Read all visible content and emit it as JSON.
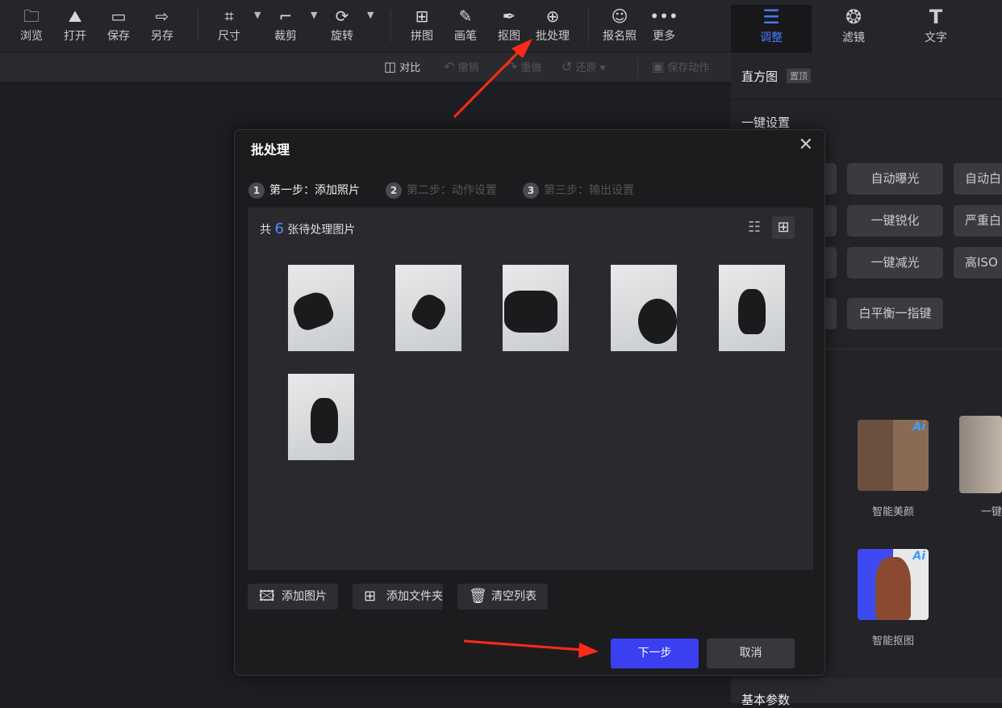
{
  "toolbar": {
    "items": [
      {
        "label": "浏览",
        "icon": "folder-icon"
      },
      {
        "label": "打开",
        "icon": "open-image-icon"
      },
      {
        "label": "保存",
        "icon": "save-icon"
      },
      {
        "label": "另存",
        "icon": "save-as-icon"
      },
      {
        "label": "尺寸",
        "icon": "resize-icon"
      },
      {
        "label": "裁剪",
        "icon": "crop-icon"
      },
      {
        "label": "旋转",
        "icon": "rotate-icon"
      },
      {
        "label": "拼图",
        "icon": "collage-icon"
      },
      {
        "label": "画笔",
        "icon": "brush-icon"
      },
      {
        "label": "抠图",
        "icon": "pen-cutout-icon"
      },
      {
        "label": "批处理",
        "icon": "batch-icon"
      },
      {
        "label": "报名照",
        "icon": "id-photo-icon"
      },
      {
        "label": "更多",
        "icon": "more-icon"
      }
    ]
  },
  "subbar": {
    "compare": "对比",
    "undo": "撤销",
    "redo": "重做",
    "restore": "还原",
    "save_action": "保存动作"
  },
  "right_tabs": [
    {
      "label": "调整",
      "active": true
    },
    {
      "label": "滤镜"
    },
    {
      "label": "文字"
    }
  ],
  "panel": {
    "histogram": "直方图",
    "pin": "置顶",
    "one_click": "一键设置",
    "buttons": [
      "自动曝光",
      "自动白",
      "一键锐化",
      "严重白",
      "一键减光",
      "高ISO",
      "白平衡一指键"
    ],
    "cards": [
      "智能美颜",
      "一键",
      "智能抠图"
    ],
    "ai_badge": "Ai",
    "basic_params": "基本参数"
  },
  "dialog": {
    "title": "批处理",
    "steps": [
      {
        "num": "1",
        "label": "第一步：添加照片"
      },
      {
        "num": "2",
        "label": "第二步：动作设置"
      },
      {
        "num": "3",
        "label": "第三步：输出设置"
      }
    ],
    "count_prefix": "共",
    "count": "6",
    "count_suffix": "张待处理图片",
    "add_images": "添加图片",
    "add_folder": "添加文件夹",
    "clear_list": "清空列表",
    "next": "下一步",
    "cancel": "取消"
  },
  "colors": {
    "accent": "#3a3ff0",
    "arrow": "#ff2a1a",
    "tab_active": "#4a7dff"
  }
}
